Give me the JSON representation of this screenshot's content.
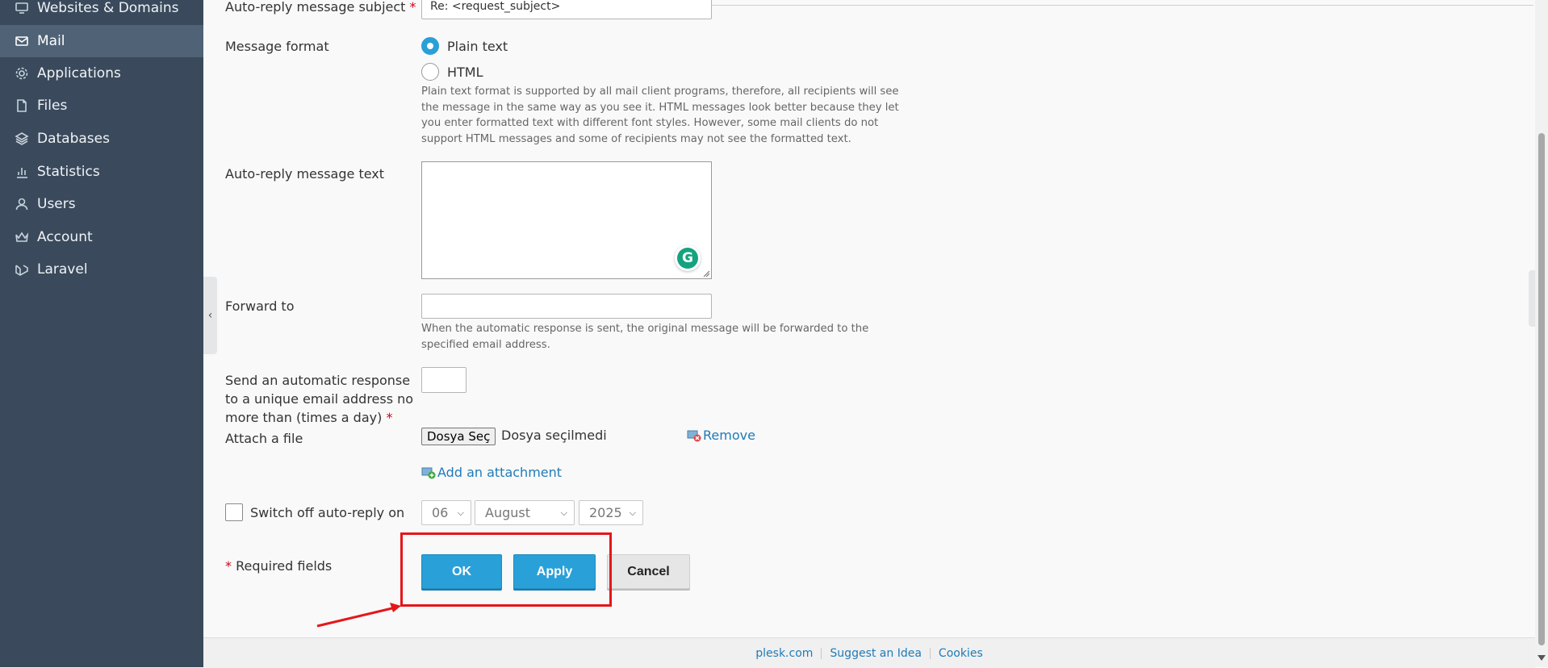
{
  "sidebar": {
    "items": [
      {
        "label": "Websites & Domains",
        "icon": "monitor-icon"
      },
      {
        "label": "Mail",
        "icon": "envelope-icon",
        "active": true
      },
      {
        "label": "Applications",
        "icon": "gear-icon"
      },
      {
        "label": "Files",
        "icon": "file-icon"
      },
      {
        "label": "Databases",
        "icon": "layers-icon"
      },
      {
        "label": "Statistics",
        "icon": "bar-chart-icon"
      },
      {
        "label": "Users",
        "icon": "user-icon"
      },
      {
        "label": "Account",
        "icon": "crown-icon"
      },
      {
        "label": "Laravel",
        "icon": "laravel-icon"
      }
    ]
  },
  "form": {
    "subject": {
      "label": "Auto-reply message subject",
      "required_mark": "*",
      "value": "Re: <request_subject>"
    },
    "message_format": {
      "label": "Message format",
      "options": [
        "Plain text",
        "HTML"
      ],
      "selected": "Plain text",
      "help_lines": [
        "Plain text format is supported by all mail client programs, therefore, all recipients will see",
        "the message in the same way as you see it. HTML messages look better because they let",
        "you enter formatted text with different font styles. However, some mail clients do not",
        "support HTML messages and some of recipients may not see the formatted text."
      ]
    },
    "message_text": {
      "label": "Auto-reply message text",
      "value": "",
      "grammarly_glyph": "G"
    },
    "forward_to": {
      "label": "Forward to",
      "value": "",
      "help_lines": [
        "When the automatic response is sent, the original message will be forwarded to the",
        "specified email address."
      ]
    },
    "frequency": {
      "label_lines": [
        "Send an automatic response",
        "to a unique email address no",
        "more than (times a day)"
      ],
      "required_mark": "*",
      "value": ""
    },
    "attachment": {
      "label": "Attach a file",
      "choose_button": "Dosya Seç",
      "no_file_text": "Dosya seçilmedi",
      "remove_label": "Remove",
      "add_label": "Add an attachment"
    },
    "switch_off": {
      "label": "Switch off auto-reply on",
      "checked": false,
      "day": "06",
      "month": "August",
      "year": "2025"
    },
    "required_note": {
      "mark": "*",
      "text": "Required fields"
    },
    "buttons": {
      "ok": "OK",
      "apply": "Apply",
      "cancel": "Cancel"
    }
  },
  "footer": {
    "links": [
      "plesk.com",
      "Suggest an Idea",
      "Cookies"
    ]
  },
  "colors": {
    "accent": "#2aa0d8",
    "sidebar": "#3a4a5c",
    "highlight": "#e5161a",
    "link": "#1f7bb8"
  }
}
